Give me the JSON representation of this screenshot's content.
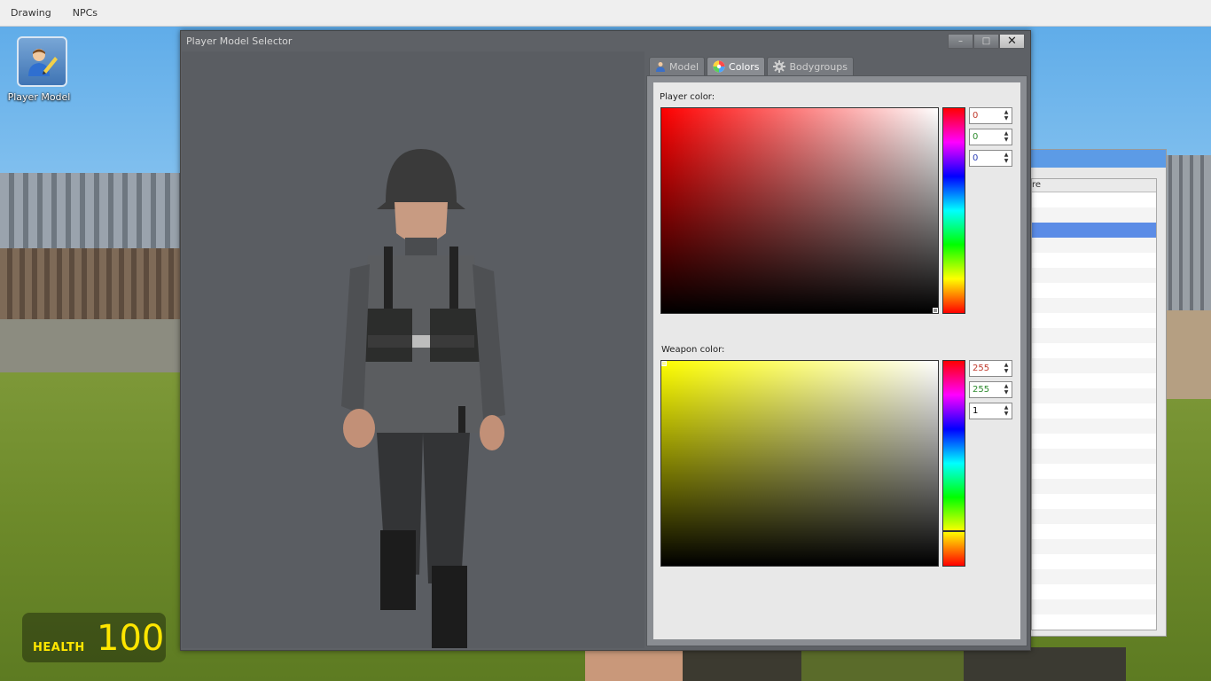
{
  "menubar": {
    "items": [
      "Drawing",
      "NPCs"
    ]
  },
  "desktop": {
    "icon_label": "Player Model"
  },
  "hud": {
    "label": "HEALTH",
    "value": "100"
  },
  "background_window": {
    "header_fragment": "re"
  },
  "window": {
    "title": "Player Model Selector",
    "buttons": {
      "minimize": "–",
      "maximize": "□",
      "close": "✕"
    },
    "tabs": [
      {
        "label": "Model",
        "icon": "person-icon",
        "active": false
      },
      {
        "label": "Colors",
        "icon": "color-wheel-icon",
        "active": true
      },
      {
        "label": "Bodygroups",
        "icon": "gear-icon",
        "active": false
      }
    ],
    "player_color": {
      "label": "Player color:",
      "hue_color": "#ff0000",
      "r": "0",
      "g": "0",
      "b": "0"
    },
    "weapon_color": {
      "label": "Weapon color:",
      "hue_color": "#ffff00",
      "r": "255",
      "g": "255",
      "b": "1"
    }
  },
  "colors": {
    "window_bg": "#5e6166",
    "panel_bg": "#e8e8e8",
    "hud_text": "#ffe600",
    "selection": "#5b8ce6"
  }
}
